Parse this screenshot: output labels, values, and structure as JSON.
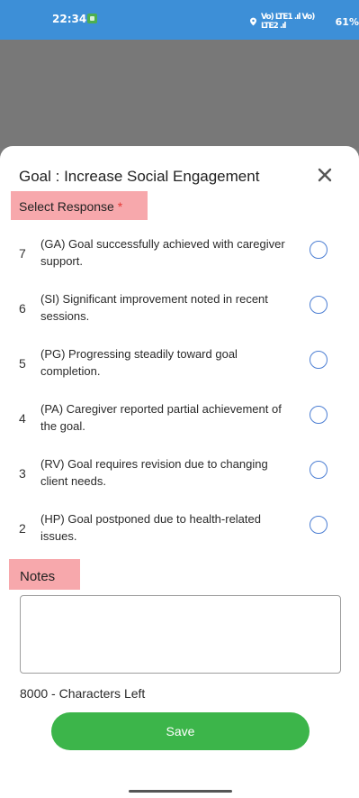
{
  "status_bar": {
    "time": "22:34",
    "signal_text": "Vo) LTE1 .ıl Vo) LTE2 .ıl",
    "battery": "61%",
    "icons": [
      "app-notification-icon",
      "location-icon",
      "signal-icon"
    ]
  },
  "goal": {
    "title": "Goal : Increase Social Engagement"
  },
  "select_response": {
    "label": "Select Response",
    "required_mark": "*"
  },
  "options": [
    {
      "score": "7",
      "text": "(GA) Goal successfully achieved with caregiver support.",
      "selected": false
    },
    {
      "score": "6",
      "text": "(SI) Significant improvement noted in recent sessions.",
      "selected": false
    },
    {
      "score": "5",
      "text": "(PG) Progressing steadily toward goal completion.",
      "selected": false
    },
    {
      "score": "4",
      "text": "(PA) Caregiver reported partial achievement of the goal.",
      "selected": false
    },
    {
      "score": "3",
      "text": "(RV) Goal requires revision due to changing client needs.",
      "selected": false
    },
    {
      "score": "2",
      "text": "(HP) Goal postponed due to health-related issues.",
      "selected": false
    }
  ],
  "notes": {
    "label": "Notes",
    "value": "",
    "characters_left": "8000 - Characters Left"
  },
  "save_label": "Save",
  "colors": {
    "status_bar": "#3d8fd7",
    "highlight": "#f7a8ac",
    "radio": "#4d7fd3",
    "save_button": "#3cb54a",
    "required": "#e53935"
  }
}
